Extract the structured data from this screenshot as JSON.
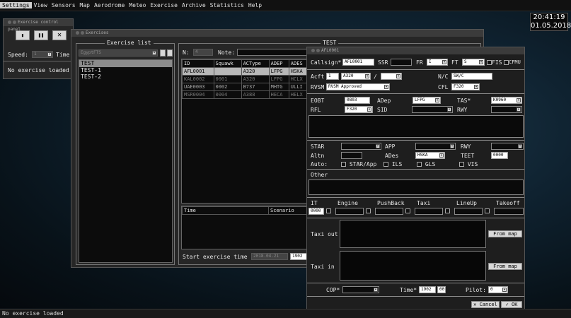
{
  "menubar": {
    "items": [
      "Settings",
      "View",
      "Sensors",
      "Map",
      "Aerodrome",
      "Meteo",
      "Exercise",
      "Archive",
      "Statistics",
      "Help"
    ]
  },
  "clock": {
    "time": "20:41:19",
    "date": "01.05.2018"
  },
  "status": {
    "text": "No exercise loaded"
  },
  "control_panel": {
    "title": "Exercise control panel",
    "speed_label": "Speed:",
    "speed_value": "1",
    "time_label": "Time:",
    "status": "No exercise loaded"
  },
  "exercises_window": {
    "title": "Exercises"
  },
  "exercise_list": {
    "title": "Exercise list",
    "filter_value": "EgyptFTS",
    "items": [
      "TEST",
      "TEST-1",
      "TEST-2"
    ]
  },
  "exercise_detail": {
    "title": "TEST",
    "n_label": "N:",
    "n_value": "4",
    "note_label": "Note:",
    "flights_columns": [
      "ID",
      "Squawk",
      "ACType",
      "ADEP",
      "ADES"
    ],
    "flights": [
      [
        "AFL0001",
        "",
        "A320",
        "LFPG",
        "HSKA"
      ],
      [
        "KAL0002",
        "0001",
        "A320",
        "LFPG",
        "HCLX"
      ],
      [
        "UAE0003",
        "0002",
        "B737",
        "MHTG",
        "ULLI"
      ],
      [
        "MSR0004",
        "0004",
        "A388",
        "HECA",
        "HELX"
      ]
    ],
    "events_columns": [
      "Time",
      "Scenario"
    ],
    "start_label": "Start exercise time :",
    "start_date": "2018.04.21",
    "start_time": "1902"
  },
  "flight_dialog": {
    "title": "AFL0001",
    "callsign_label": "Callsign*",
    "callsign_value": "AFL0001",
    "ssr_label": "SSR",
    "fr_label": "FR",
    "fr_value": "I",
    "ft_label": "FT",
    "ft_value": "S",
    "fis_label": "FIS",
    "cfmu_label": "CFMU",
    "acft_label": "Acft",
    "acft_count": "1",
    "acft_type": "A320",
    "slash": "/",
    "nc_label": "N/C",
    "nc_value": "SW/C",
    "rvsm_label": "RVSM",
    "rvsm_value": "RVSM Approved",
    "cfl_label": "CFL",
    "cfl_value": "F320",
    "eobt_label": "EOBT",
    "eobt_value": "0803",
    "adep_label": "ADep",
    "adep_value": "LFPG",
    "tas_label": "TAS*",
    "tas_value": "K0960",
    "rfl_label": "RFL",
    "rfl_value": "F320",
    "sid_label": "SID",
    "rwy_label": "RWY",
    "star_label": "STAR",
    "app_label": "APP",
    "altn_label": "Altn",
    "ades_label": "ADes",
    "ades_value": "HSKA",
    "teet_label": "TEET",
    "teet_value": "0000",
    "auto_label": "Auto:",
    "auto_starapp": "STAR/App",
    "auto_ils": "ILS",
    "auto_gls": "GLS",
    "auto_vis": "VIS",
    "other_label": "Other",
    "it_label": "IT",
    "it_value": "0000",
    "engine_label": "Engine",
    "pushback_label": "PushBack",
    "taxi_label": "Taxi",
    "lineup_label": "LineUp",
    "takeoff_label": "Takeoff",
    "taxi_out_label": "Taxi out",
    "taxi_in_label": "Taxi in",
    "from_map_label": "From map",
    "cop_label": "COP*",
    "time_label": "Time*",
    "time_value": "1902",
    "time_sec": "00",
    "pilot_label": "Pilot:",
    "pilot_value": "0",
    "cancel_label": "Cancel",
    "ok_label": "OK"
  }
}
